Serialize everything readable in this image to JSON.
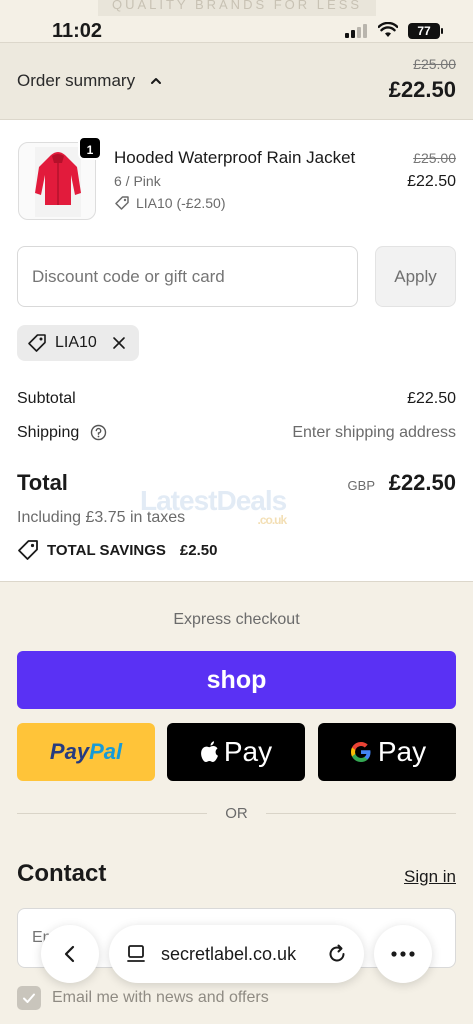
{
  "status_bar": {
    "time": "11:02",
    "battery": "77",
    "promo_text": "QUALITY BRANDS FOR LESS"
  },
  "summary_bar": {
    "toggle_label": "Order summary",
    "original_total": "£25.00",
    "total": "£22.50"
  },
  "line_item": {
    "quantity": "1",
    "name": "Hooded Waterproof Rain Jacket",
    "variant": "6 / Pink",
    "discount": "LIA10 (-£2.50)",
    "original_price": "£25.00",
    "price": "£22.50"
  },
  "discount_form": {
    "placeholder": "Discount code or gift card",
    "apply_label": "Apply",
    "applied_code": "LIA10"
  },
  "totals": {
    "subtotal_label": "Subtotal",
    "subtotal_value": "£22.50",
    "shipping_label": "Shipping",
    "shipping_value": "Enter shipping address",
    "total_label": "Total",
    "currency": "GBP",
    "total_value": "£22.50",
    "tax_note": "Including £3.75 in taxes",
    "savings_label": "TOTAL SAVINGS",
    "savings_value": "£2.50"
  },
  "watermark": {
    "name": "LatestDeals",
    "domain": ".co.uk"
  },
  "express": {
    "title": "Express checkout",
    "shop_label": "shop",
    "paypal_pay": "Pay",
    "paypal_pal": "Pal",
    "apple_pay_label": "Pay",
    "google_pay_label": "Pay",
    "or_label": "OR"
  },
  "contact": {
    "title": "Contact",
    "sign_in_label": "Sign in",
    "email_placeholder": "Email",
    "newsletter_label": "Email me with news and offers",
    "newsletter_checked": true
  },
  "browser": {
    "url": "secretlabel.co.uk"
  },
  "colors": {
    "page_bg": "#f4f0e6",
    "shop_purple": "#5a31f4",
    "paypal_yellow": "#ffc439",
    "product_red": "#e21b3c"
  }
}
